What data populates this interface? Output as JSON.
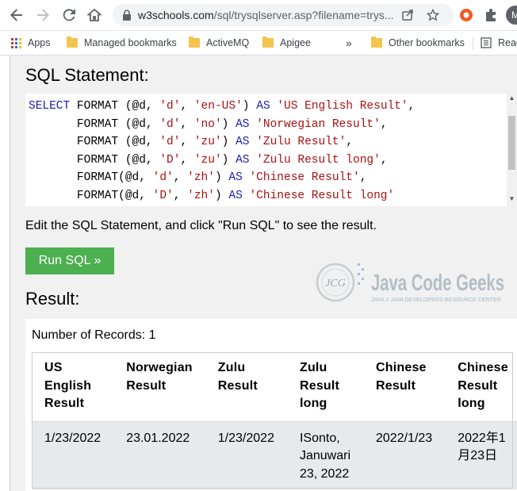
{
  "browser": {
    "url_host": "w3schools.com",
    "url_path": "/sql/trysqlserver.asp?filename=trys...",
    "avatar_letter": "M"
  },
  "bookmarks": {
    "apps": "Apps",
    "items": [
      "Managed bookmarks",
      "ActiveMQ",
      "Apigee"
    ],
    "overflow": "»",
    "other": "Other bookmarks",
    "reading": "Read"
  },
  "editor": {
    "heading": "SQL Statement:",
    "lines": [
      {
        "prefix": "SELECT",
        "rest": " FORMAT (@d, ",
        "a": "'d'",
        "b": ", ",
        "c": "'en-US'",
        "d": ") ",
        "kw": "AS",
        "e": " ",
        "alias": "'US English Result'",
        "end": ","
      },
      {
        "prefix": "      ",
        "rest": " FORMAT (@d, ",
        "a": "'d'",
        "b": ", ",
        "c": "'no'",
        "d": ") ",
        "kw": "AS",
        "e": " ",
        "alias": "'Norwegian Result'",
        "end": ","
      },
      {
        "prefix": "      ",
        "rest": " FORMAT (@d, ",
        "a": "'d'",
        "b": ", ",
        "c": "'zu'",
        "d": ") ",
        "kw": "AS",
        "e": " ",
        "alias": "'Zulu Result'",
        "end": ","
      },
      {
        "prefix": "      ",
        "rest": " FORMAT (@d, ",
        "a": "'D'",
        "b": ", ",
        "c": "'zu'",
        "d": ") ",
        "kw": "AS",
        "e": " ",
        "alias": "'Zulu Result long'",
        "end": ","
      },
      {
        "prefix": "      ",
        "rest": " FORMAT(@d, ",
        "a": "'d'",
        "b": ", ",
        "c": "'zh'",
        "d": ") ",
        "kw": "AS",
        "e": " ",
        "alias": "'Chinese Result'",
        "end": ","
      },
      {
        "prefix": "      ",
        "rest": " FORMAT(@d, ",
        "a": "'D'",
        "b": ", ",
        "c": "'zh'",
        "d": ") ",
        "kw": "AS",
        "e": " ",
        "alias": "'Chinese Result long'",
        "end": ""
      }
    ]
  },
  "instruction": "Edit the SQL Statement, and click \"Run SQL\" to see the result.",
  "run_button": "Run SQL »",
  "result": {
    "heading": "Result:",
    "records": "Number of Records: 1",
    "columns": [
      "US English Result",
      "Norwegian Result",
      "Zulu Result",
      "Zulu Result long",
      "Chinese Result",
      "Chinese Result long"
    ],
    "row": [
      "1/23/2022",
      "23.01.2022",
      "1/23/2022",
      "ISonto, Januwari 23, 2022",
      "2022/1/23",
      "2022年1月23日"
    ]
  },
  "watermark": {
    "brand": "Java Code Geeks",
    "tagline": "JAVA 2 JAVA DEVELOPERS RESOURCE CENTER",
    "badge": "JCG"
  },
  "colors": {
    "run_button": "#4caf50",
    "keyword": "#1c1cb3",
    "string": "#a11111"
  }
}
